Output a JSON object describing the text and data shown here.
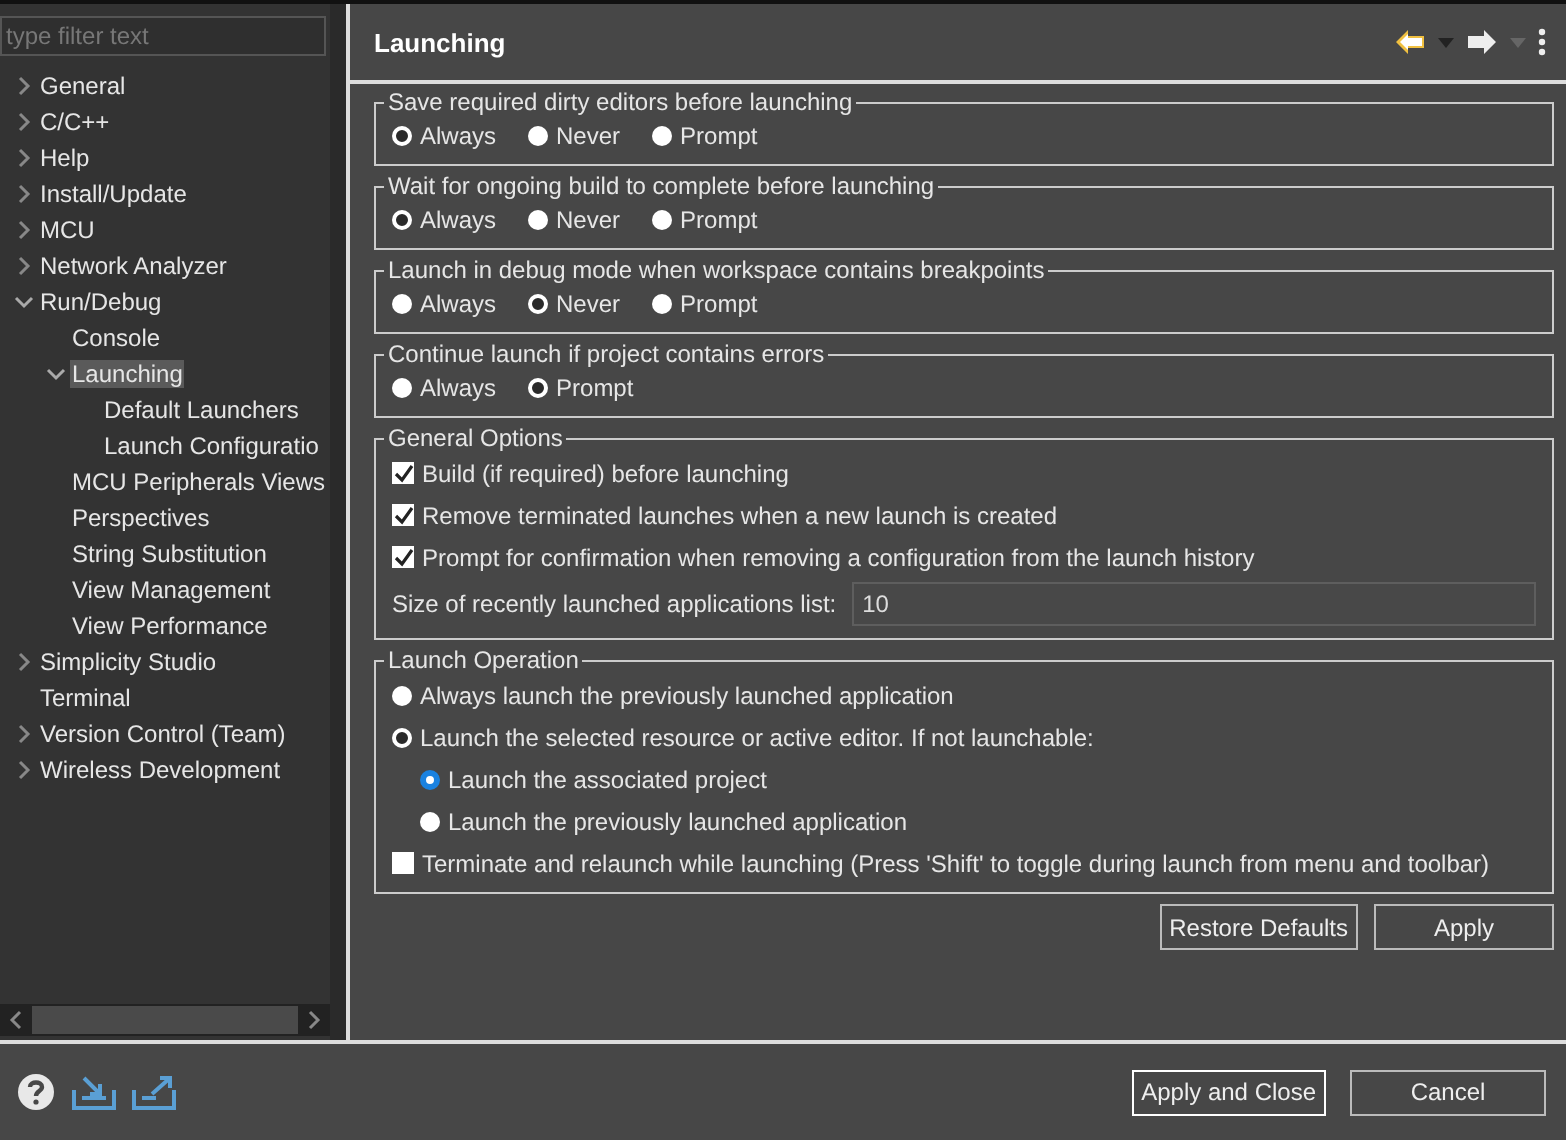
{
  "sidebar": {
    "filter": {
      "placeholder": "type filter text"
    },
    "tree": [
      {
        "label": "General",
        "expanded": false,
        "selected": false
      },
      {
        "label": "C/C++",
        "expanded": false,
        "selected": false
      },
      {
        "label": "Help",
        "expanded": false,
        "selected": false
      },
      {
        "label": "Install/Update",
        "expanded": false,
        "selected": false
      },
      {
        "label": "MCU",
        "expanded": false,
        "selected": false
      },
      {
        "label": "Network Analyzer",
        "expanded": false,
        "selected": false
      },
      {
        "label": "Run/Debug",
        "expanded": true,
        "selected": false,
        "children": [
          {
            "label": "Console",
            "selected": false
          },
          {
            "label": "Launching",
            "expanded": true,
            "selected": true,
            "children": [
              {
                "label": "Default Launchers",
                "selected": false
              },
              {
                "label": "Launch Configuratio",
                "selected": false
              }
            ]
          },
          {
            "label": "MCU Peripherals Views",
            "selected": false
          },
          {
            "label": "Perspectives",
            "selected": false
          },
          {
            "label": "String Substitution",
            "selected": false
          },
          {
            "label": "View Management",
            "selected": false
          },
          {
            "label": "View Performance",
            "selected": false
          }
        ]
      },
      {
        "label": "Simplicity Studio",
        "expanded": false,
        "selected": false
      },
      {
        "label": "Terminal",
        "selected": false
      },
      {
        "label": "Version Control (Team)",
        "expanded": false,
        "selected": false
      },
      {
        "label": "Wireless Development",
        "expanded": false,
        "selected": false
      }
    ]
  },
  "page": {
    "title": "Launching",
    "radio_groups": [
      {
        "title": "Save required dirty editors before launching",
        "options": [
          {
            "label": "Always",
            "selected": true
          },
          {
            "label": "Never",
            "selected": false
          },
          {
            "label": "Prompt",
            "selected": false
          }
        ]
      },
      {
        "title": "Wait for ongoing build to complete before launching",
        "options": [
          {
            "label": "Always",
            "selected": true
          },
          {
            "label": "Never",
            "selected": false
          },
          {
            "label": "Prompt",
            "selected": false
          }
        ]
      },
      {
        "title": "Launch in debug mode when workspace contains breakpoints",
        "options": [
          {
            "label": "Always",
            "selected": false
          },
          {
            "label": "Never",
            "selected": true
          },
          {
            "label": "Prompt",
            "selected": false
          }
        ]
      },
      {
        "title": "Continue launch if project contains errors",
        "options": [
          {
            "label": "Always",
            "selected": false
          },
          {
            "label": "Prompt",
            "selected": true
          }
        ]
      }
    ],
    "general_options": {
      "title": "General Options",
      "checkboxes": [
        {
          "label": "Build (if required) before launching",
          "checked": true
        },
        {
          "label": "Remove terminated launches when a new launch is created",
          "checked": true
        },
        {
          "label": "Prompt for confirmation when removing a configuration from the launch history",
          "checked": true
        }
      ],
      "size_field": {
        "label": "Size of recently launched applications list:",
        "value": "10"
      }
    },
    "launch_operation": {
      "title": "Launch Operation",
      "options": [
        {
          "label": "Always launch the previously launched application",
          "selected": false
        },
        {
          "label": "Launch the selected resource or active editor. If not launchable:",
          "selected": true,
          "children": [
            {
              "label": "Launch the associated project",
              "selected": true
            },
            {
              "label": "Launch the previously launched application",
              "selected": false
            }
          ]
        }
      ],
      "terminate": {
        "label": "Terminate and relaunch while launching (Press 'Shift' to toggle during launch from menu and toolbar)",
        "checked": false
      }
    },
    "buttons": [
      "Restore Defaults",
      "Apply"
    ]
  },
  "footer_buttons": [
    "Apply and Close",
    "Cancel"
  ]
}
